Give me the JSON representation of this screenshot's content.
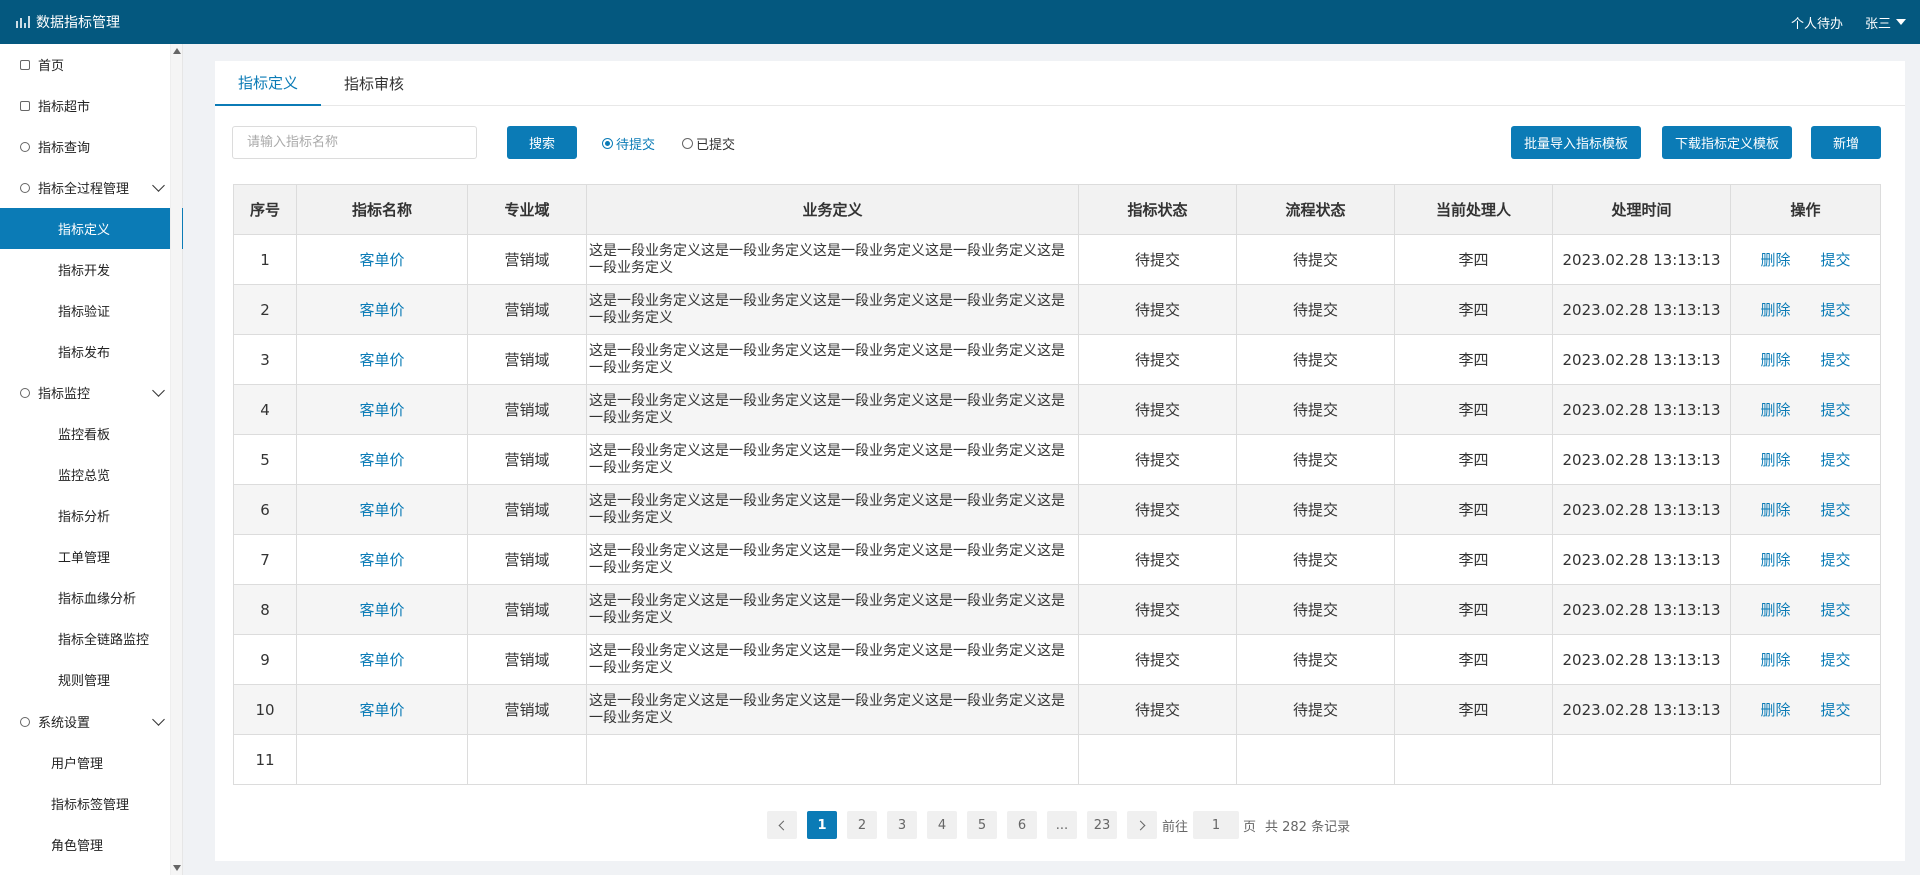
{
  "app": {
    "title": "数据指标管理",
    "icon": "chart-icon"
  },
  "header": {
    "todo_label": "个人待办",
    "user_name": "张三"
  },
  "sidebar": {
    "items": [
      {
        "label": "首页",
        "icon": "home-icon",
        "level": 0
      },
      {
        "label": "指标超市",
        "icon": "cart-icon",
        "level": 0
      },
      {
        "label": "指标查询",
        "icon": "search-icon",
        "level": 0
      },
      {
        "label": "指标全过程管理",
        "icon": "circle-icon",
        "level": 0,
        "expanded": true
      },
      {
        "label": "指标定义",
        "level": 1,
        "active": true
      },
      {
        "label": "指标开发",
        "level": 1
      },
      {
        "label": "指标验证",
        "level": 1
      },
      {
        "label": "指标发布",
        "level": 1
      },
      {
        "label": "指标监控",
        "icon": "monitor-icon",
        "level": 0,
        "expanded": true
      },
      {
        "label": "监控看板",
        "level": 1
      },
      {
        "label": "监控总览",
        "level": 1
      },
      {
        "label": "指标分析",
        "level": 1
      },
      {
        "label": "工单管理",
        "level": 1
      },
      {
        "label": "指标血缘分析",
        "level": 1
      },
      {
        "label": "指标全链路监控",
        "level": 1
      },
      {
        "label": "规则管理",
        "level": 1
      },
      {
        "label": "系统设置",
        "icon": "gear-icon",
        "level": 0,
        "expanded": true
      },
      {
        "label": "用户管理",
        "level": 2
      },
      {
        "label": "指标标签管理",
        "level": 2
      },
      {
        "label": "角色管理",
        "level": 2
      }
    ]
  },
  "tabs": [
    {
      "label": "指标定义",
      "active": true
    },
    {
      "label": "指标审核",
      "active": false
    }
  ],
  "toolbar": {
    "search_placeholder": "请输入指标名称",
    "search_label": "搜索",
    "radio_pending": "待提交",
    "radio_submitted": "已提交",
    "import_label": "批量导入指标模板",
    "download_label": "下载指标定义模板",
    "add_label": "新增"
  },
  "table": {
    "columns": [
      "序号",
      "指标名称",
      "专业域",
      "业务定义",
      "指标状态",
      "流程状态",
      "当前处理人",
      "处理时间",
      "操作"
    ],
    "delete_label": "删除",
    "submit_label": "提交",
    "rows": [
      {
        "no": "1",
        "name": "客单价",
        "domain": "营销域",
        "definition": "这是一段业务定义这是一段业务定义这是一段业务定义这是一段业务定义这是一段业务定义",
        "status": "待提交",
        "flow": "待提交",
        "handler": "李四",
        "time": "2023.02.28 13:13:13"
      },
      {
        "no": "2",
        "name": "客单价",
        "domain": "营销域",
        "definition": "这是一段业务定义这是一段业务定义这是一段业务定义这是一段业务定义这是一段业务定义",
        "status": "待提交",
        "flow": "待提交",
        "handler": "李四",
        "time": "2023.02.28 13:13:13"
      },
      {
        "no": "3",
        "name": "客单价",
        "domain": "营销域",
        "definition": "这是一段业务定义这是一段业务定义这是一段业务定义这是一段业务定义这是一段业务定义",
        "status": "待提交",
        "flow": "待提交",
        "handler": "李四",
        "time": "2023.02.28 13:13:13"
      },
      {
        "no": "4",
        "name": "客单价",
        "domain": "营销域",
        "definition": "这是一段业务定义这是一段业务定义这是一段业务定义这是一段业务定义这是一段业务定义",
        "status": "待提交",
        "flow": "待提交",
        "handler": "李四",
        "time": "2023.02.28 13:13:13"
      },
      {
        "no": "5",
        "name": "客单价",
        "domain": "营销域",
        "definition": "这是一段业务定义这是一段业务定义这是一段业务定义这是一段业务定义这是一段业务定义",
        "status": "待提交",
        "flow": "待提交",
        "handler": "李四",
        "time": "2023.02.28 13:13:13"
      },
      {
        "no": "6",
        "name": "客单价",
        "domain": "营销域",
        "definition": "这是一段业务定义这是一段业务定义这是一段业务定义这是一段业务定义这是一段业务定义",
        "status": "待提交",
        "flow": "待提交",
        "handler": "李四",
        "time": "2023.02.28 13:13:13"
      },
      {
        "no": "7",
        "name": "客单价",
        "domain": "营销域",
        "definition": "这是一段业务定义这是一段业务定义这是一段业务定义这是一段业务定义这是一段业务定义",
        "status": "待提交",
        "flow": "待提交",
        "handler": "李四",
        "time": "2023.02.28 13:13:13"
      },
      {
        "no": "8",
        "name": "客单价",
        "domain": "营销域",
        "definition": "这是一段业务定义这是一段业务定义这是一段业务定义这是一段业务定义这是一段业务定义",
        "status": "待提交",
        "flow": "待提交",
        "handler": "李四",
        "time": "2023.02.28 13:13:13"
      },
      {
        "no": "9",
        "name": "客单价",
        "domain": "营销域",
        "definition": "这是一段业务定义这是一段业务定义这是一段业务定义这是一段业务定义这是一段业务定义",
        "status": "待提交",
        "flow": "待提交",
        "handler": "李四",
        "time": "2023.02.28 13:13:13"
      },
      {
        "no": "10",
        "name": "客单价",
        "domain": "营销域",
        "definition": "这是一段业务定义这是一段业务定义这是一段业务定义这是一段业务定义这是一段业务定义",
        "status": "待提交",
        "flow": "待提交",
        "handler": "李四",
        "time": "2023.02.28 13:13:13"
      }
    ],
    "empty_row_no": "11"
  },
  "pagination": {
    "pages": [
      "1",
      "2",
      "3",
      "4",
      "5",
      "6",
      "...",
      "23"
    ],
    "current": "1",
    "goto_label": "前往",
    "goto_value": "1",
    "page_unit": "页",
    "total_text": "共 282 条记录"
  },
  "colors": {
    "header": "#04587f",
    "accent": "#0b7bb6"
  }
}
